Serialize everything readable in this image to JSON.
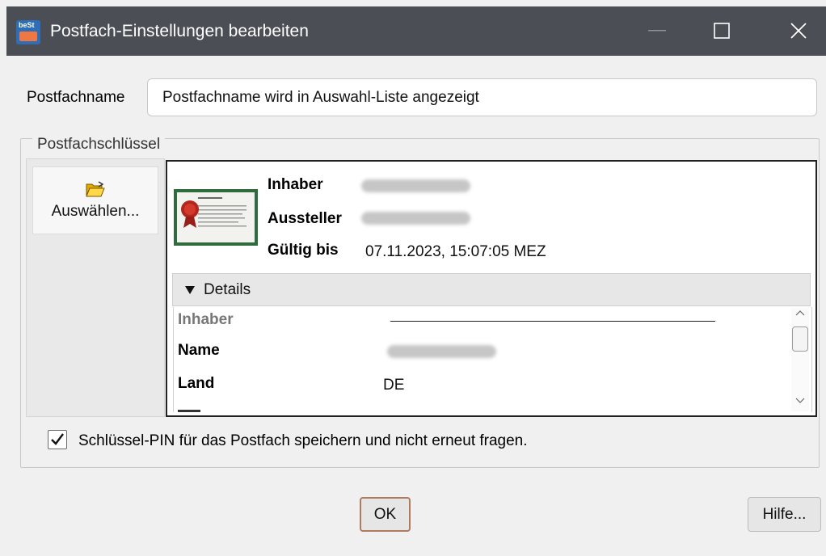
{
  "window": {
    "title": "Postfach-Einstellungen bearbeiten",
    "app_icon_text": "beSt"
  },
  "controls": {
    "minimize": "minimize-icon",
    "maximize": "maximize-icon",
    "close": "close-icon"
  },
  "mailbox": {
    "name_label": "Postfachname",
    "name_value": "Postfachname wird in Auswahl-Liste angezeigt"
  },
  "key": {
    "legend": "Postfachschlüssel",
    "select_label": "Auswählen...",
    "select_icon": "folder-open-icon",
    "certificate": {
      "owner_label": "Inhaber",
      "issuer_label": "Aussteller",
      "valid_until_label": "Gültig bis",
      "valid_until_value": "07.11.2023, 15:07:05 MEZ"
    },
    "details": {
      "header": "Details",
      "toggle_icon": "triangle-down-icon",
      "section_owner": "Inhaber",
      "name_label": "Name",
      "country_label": "Land",
      "country_value": "DE"
    },
    "save_pin_label": "Schlüssel-PIN für das Postfach speichern und nicht erneut fragen.",
    "save_pin_checked": true
  },
  "buttons": {
    "ok": "OK",
    "help": "Hilfe..."
  }
}
